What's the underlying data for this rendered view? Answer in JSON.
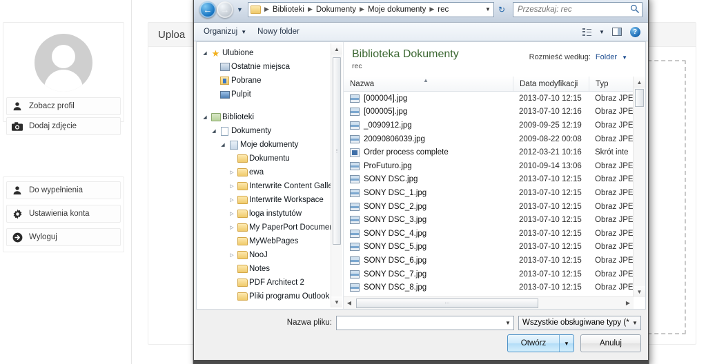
{
  "background": {
    "upload_title": "Uploa",
    "menu_groups": [
      {
        "items": [
          {
            "label": "Zobacz profil",
            "icon": "user-icon"
          },
          {
            "label": "Dodaj zdjęcie",
            "icon": "camera-icon"
          }
        ]
      },
      {
        "items": [
          {
            "label": "Do wypełnienia",
            "icon": "user-icon"
          },
          {
            "label": "Ustawienia konta",
            "icon": "gear-icon"
          },
          {
            "label": "Wyloguj",
            "icon": "logout-arrow-icon"
          }
        ]
      }
    ]
  },
  "dialog": {
    "address": {
      "back_icon": "back-arrow-icon",
      "forward_icon": "forward-arrow-icon",
      "history_icon": "chevron-down-icon",
      "folder_icon": "folder-icon",
      "crumbs": [
        "Biblioteki",
        "Dokumenty",
        "Moje dokumenty",
        "rec"
      ],
      "dropdown_icon": "chevron-down-icon",
      "refresh_icon": "refresh-icon"
    },
    "search": {
      "placeholder": "Przeszukaj: rec",
      "value": "",
      "icon": "search-icon"
    },
    "commandbar": {
      "organize": "Organizuj",
      "new_folder": "Nowy folder",
      "view_icon": "view-list-icon",
      "view_caret_icon": "chevron-down-icon",
      "preview_pane_icon": "preview-pane-icon",
      "help_icon": "help-icon"
    },
    "nav_tree": [
      {
        "label": "Ulubione",
        "icon": "star-icon",
        "indent": 0,
        "expander": "open"
      },
      {
        "label": "Ostatnie miejsca",
        "icon": "recent-places-icon",
        "indent": 1,
        "expander": "none"
      },
      {
        "label": "Pobrane",
        "icon": "downloads-icon",
        "indent": 1,
        "expander": "none"
      },
      {
        "label": "Pulpit",
        "icon": "desktop-icon",
        "indent": 1,
        "expander": "none"
      },
      {
        "label": "",
        "icon": "gap",
        "indent": 0,
        "expander": "none"
      },
      {
        "label": "Biblioteki",
        "icon": "libraries-icon",
        "indent": 0,
        "expander": "open"
      },
      {
        "label": "Dokumenty",
        "icon": "document-library-icon",
        "indent": 1,
        "expander": "open"
      },
      {
        "label": "Moje dokumenty",
        "icon": "my-documents-icon",
        "indent": 2,
        "expander": "open"
      },
      {
        "label": "Dokumentu",
        "icon": "folder-icon",
        "indent": 3,
        "expander": "none"
      },
      {
        "label": "ewa",
        "icon": "folder-icon",
        "indent": 3,
        "expander": "closed"
      },
      {
        "label": "Interwrite Content Gallery",
        "icon": "folder-icon",
        "indent": 3,
        "expander": "closed"
      },
      {
        "label": "Interwrite Workspace",
        "icon": "folder-icon",
        "indent": 3,
        "expander": "closed"
      },
      {
        "label": "loga instytutów",
        "icon": "folder-icon",
        "indent": 3,
        "expander": "closed"
      },
      {
        "label": "My PaperPort Documents",
        "icon": "folder-icon",
        "indent": 3,
        "expander": "closed"
      },
      {
        "label": "MyWebPages",
        "icon": "folder-icon",
        "indent": 3,
        "expander": "none"
      },
      {
        "label": "NooJ",
        "icon": "folder-icon",
        "indent": 3,
        "expander": "closed"
      },
      {
        "label": "Notes",
        "icon": "folder-icon",
        "indent": 3,
        "expander": "none"
      },
      {
        "label": "PDF Architect 2",
        "icon": "folder-icon",
        "indent": 3,
        "expander": "none"
      },
      {
        "label": "Pliki programu Outlook",
        "icon": "folder-icon",
        "indent": 3,
        "expander": "none"
      }
    ],
    "library": {
      "title": "Biblioteka Dokumenty",
      "subtitle": "rec",
      "arrange_label": "Rozmieść według:",
      "arrange_value": "Folder",
      "arrange_caret_icon": "chevron-down-icon"
    },
    "columns": [
      "Nazwa",
      "Data modyfikacji",
      "Typ"
    ],
    "sort_indicator_icon": "sort-ascending-icon",
    "files": [
      {
        "name": "[000004].jpg",
        "date": "2013-07-10 12:15",
        "type": "Obraz JPE",
        "icon": "jpeg-file-icon"
      },
      {
        "name": "[000005].jpg",
        "date": "2013-07-10 12:16",
        "type": "Obraz JPE",
        "icon": "jpeg-file-icon"
      },
      {
        "name": "_0090912.jpg",
        "date": "2009-09-25 12:19",
        "type": "Obraz JPE",
        "icon": "jpeg-file-icon"
      },
      {
        "name": "20090806039.jpg",
        "date": "2009-08-22 00:08",
        "type": "Obraz JPE",
        "icon": "jpeg-file-icon"
      },
      {
        "name": "Order process complete",
        "date": "2012-03-21 10:16",
        "type": "Skrót inte",
        "icon": "internet-shortcut-icon"
      },
      {
        "name": "ProFuturo.jpg",
        "date": "2010-09-14 13:06",
        "type": "Obraz JPE",
        "icon": "jpeg-file-icon"
      },
      {
        "name": "SONY DSC.jpg",
        "date": "2013-07-10 12:15",
        "type": "Obraz JPE",
        "icon": "jpeg-file-icon"
      },
      {
        "name": "SONY DSC_1.jpg",
        "date": "2013-07-10 12:15",
        "type": "Obraz JPE",
        "icon": "jpeg-file-icon"
      },
      {
        "name": "SONY DSC_2.jpg",
        "date": "2013-07-10 12:15",
        "type": "Obraz JPE",
        "icon": "jpeg-file-icon"
      },
      {
        "name": "SONY DSC_3.jpg",
        "date": "2013-07-10 12:15",
        "type": "Obraz JPE",
        "icon": "jpeg-file-icon"
      },
      {
        "name": "SONY DSC_4.jpg",
        "date": "2013-07-10 12:15",
        "type": "Obraz JPE",
        "icon": "jpeg-file-icon"
      },
      {
        "name": "SONY DSC_5.jpg",
        "date": "2013-07-10 12:15",
        "type": "Obraz JPE",
        "icon": "jpeg-file-icon"
      },
      {
        "name": "SONY DSC_6.jpg",
        "date": "2013-07-10 12:15",
        "type": "Obraz JPE",
        "icon": "jpeg-file-icon"
      },
      {
        "name": "SONY DSC_7.jpg",
        "date": "2013-07-10 12:15",
        "type": "Obraz JPE",
        "icon": "jpeg-file-icon"
      },
      {
        "name": "SONY DSC_8.jpg",
        "date": "2013-07-10 12:15",
        "type": "Obraz JPE",
        "icon": "jpeg-file-icon"
      }
    ],
    "footer": {
      "filename_label": "Nazwa pliku:",
      "filename_value": "",
      "filename_caret_icon": "chevron-down-icon",
      "filetype_value": "Wszystkie obsługiwane typy (*.j",
      "filetype_caret_icon": "chevron-down-icon",
      "open_label": "Otwórz",
      "open_split_caret_icon": "chevron-down-icon",
      "cancel_label": "Anuluj"
    }
  }
}
